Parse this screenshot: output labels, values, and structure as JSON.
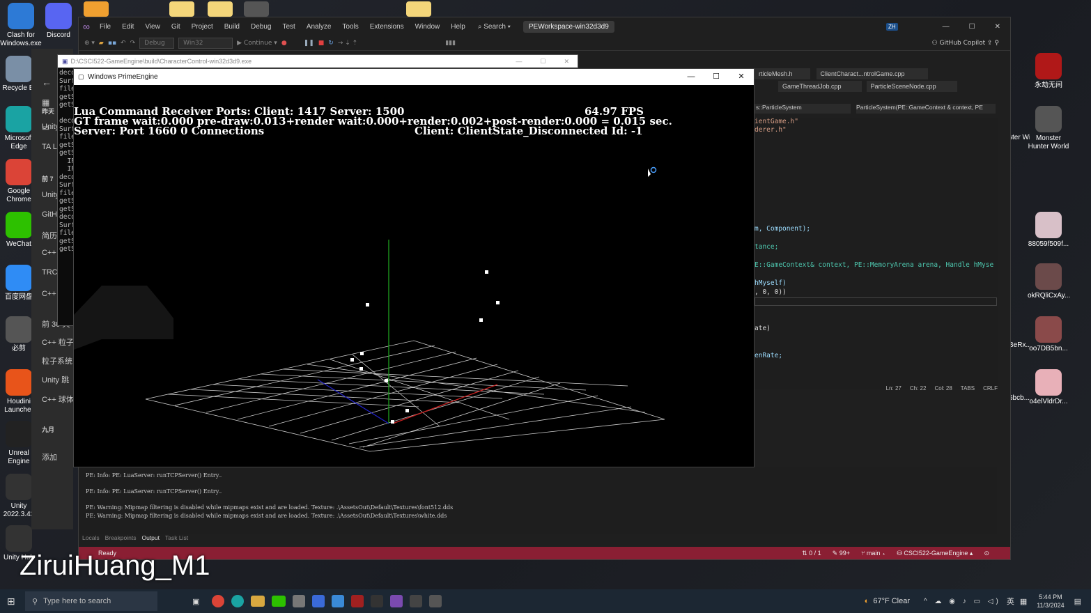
{
  "desktop": {
    "icons_left": [
      {
        "label": "Clash for Windows.exe",
        "icon": "clash-icon",
        "color": "#2d7ad6"
      },
      {
        "label": "Discord",
        "icon": "discord-icon",
        "color": "#5865f2"
      },
      {
        "label": "Recycle Bi",
        "icon": "recycle-bin-icon",
        "color": "#7a8fa6"
      },
      {
        "label": "Microsoft Edge",
        "icon": "edge-icon",
        "color": "#1aa3a3"
      },
      {
        "label": "Google Chrome",
        "icon": "chrome-icon",
        "color": "#db4437"
      },
      {
        "label": "WeChat",
        "icon": "wechat-icon",
        "color": "#2dc100"
      },
      {
        "label": "百度网盘",
        "icon": "baidu-netdisk-icon",
        "color": "#2f8cf5"
      },
      {
        "label": "必剪",
        "icon": "bijian-icon",
        "color": "#555"
      },
      {
        "label": "Houdini Launcher",
        "icon": "houdini-icon",
        "color": "#e8541a"
      },
      {
        "label": "Unreal Engine",
        "icon": "unreal-icon",
        "color": "#222"
      },
      {
        "label": "Unity 2022.3.43",
        "icon": "unity-icon",
        "color": "#333"
      },
      {
        "label": "Unity Hub",
        "icon": "unity-hub-icon",
        "color": "#333"
      }
    ],
    "icons_right": [
      {
        "label": "永劫无间",
        "icon": "naraka-icon",
        "color": "#b01818"
      },
      {
        "label": "Monster Hunter World",
        "icon": "mhw-icon",
        "color": "#555"
      },
      {
        "label": "88059f509f...",
        "icon": "image-icon",
        "color": "#d8c0c8"
      },
      {
        "label": "okRQliCxAy...",
        "icon": "image-icon",
        "color": "#6b4a4a"
      },
      {
        "label": "oo7DB5bn...",
        "icon": "image-icon",
        "color": "#8a4a4a"
      },
      {
        "label": "o4elVldrDr...",
        "icon": "image-icon",
        "color": "#e8b0b8"
      }
    ],
    "partial_icons": [
      "ster Wil...",
      "BeRx...",
      "5bcb..."
    ]
  },
  "vs": {
    "menu": [
      "File",
      "Edit",
      "View",
      "Git",
      "Project",
      "Build",
      "Debug",
      "Test",
      "Analyze",
      "Tools",
      "Extensions",
      "Window",
      "Help"
    ],
    "search": "Search",
    "solution": "PEWorkspace-win32d3d9",
    "profile": "ZH",
    "toolbar": {
      "config": "Debug",
      "platform": "Win32",
      "continue": "Continue"
    },
    "copilot": "GitHub Copilot",
    "tabs": [
      "rticleMesh.h",
      "ClientCharact...ntrolGame.cpp",
      "GameThreadJob.cpp",
      "ParticleSceneNode.cpp"
    ],
    "nav_scope": "s::ParticleSystem",
    "nav_member": "ParticleSystem(PE::GameContext & context, PE",
    "code_lines": [
      "ientGame.h\"",
      "derer.h\"",
      "m, Component);",
      "tance;",
      "E::GameContext& context, PE::MemoryArena arena, Handle hMyse",
      "hMyself)",
      ", 0, 0))",
      "ate)",
      "enRate;"
    ],
    "status_ln": "Ln: 27",
    "status_ch": "Ch: 22",
    "status_col": "Col: 28",
    "status_tabs": "TABS",
    "status_crlf": "CRLF",
    "output_lines": [
      "PE: Info: PE: LuaServer: runTCPServer() Entry..",
      "",
      "PE: Info: PE: LuaServer: runTCPServer() Entry..",
      "",
      "PE: Warning: Mipmap filtering is disabled while mipmaps exist and are loaded. Texture: .\\AssetsOut\\Default\\Textures\\font512.dds",
      "PE: Warning: Mipmap filtering is disabled while mipmaps exist and are loaded. Texture: .\\AssetsOut\\Default\\Textures\\white.dds"
    ],
    "output_tabs": [
      "Locals",
      "Breakpoints",
      "Output",
      "Task List"
    ],
    "statusbar": {
      "ready": "Ready",
      "changes": "0 / 1",
      "errors": "99+",
      "branch": "main",
      "repo": "CSCI522-GameEngine"
    }
  },
  "console": {
    "title": "D:\\CSCI522-GameEngine\\build\\CharacterControl-win32d3d9.exe",
    "lines": [
      "deco",
      "Surf",
      "file",
      "getS",
      "getS",
      "",
      "deco",
      "Surf",
      "file",
      "getS",
      "getS",
      "  IF",
      "  IF",
      "deco",
      "Surf",
      "file",
      "getS",
      "getS",
      "deco",
      "Surf",
      "file",
      "getS",
      "getS"
    ]
  },
  "history_sidebar": {
    "items": [
      "昨天",
      "Unity",
      "TA L",
      "前 7",
      "Unity",
      "GitH",
      "简历",
      "C++",
      "TRC",
      "C++ 粒子",
      "前 30 天",
      "C++ 粒子",
      "粒子系统",
      "Unity 跳",
      "C++ 球体",
      "九月",
      "添加"
    ]
  },
  "prime": {
    "title": "Windows PrimeEngine",
    "hud_line1": "Lua Command Receiver Ports: Client: 1417 Server: 1500",
    "fps": "64.97 FPS",
    "hud_line2": "GT frame wait:0.000 pre-draw:0.013+render wait:0.000+render:0.002+post-render:0.000 = 0.015 sec.",
    "hud_line3a": "Server: Port 1660 0 Connections",
    "hud_line3b": "Client: ClientState_Disconnected Id: -1"
  },
  "taskbar": {
    "search_placeholder": "Type here to search",
    "weather": "67°F Clear",
    "ime": "英",
    "time": "5:44 PM",
    "date": "11/3/2024"
  },
  "watermark": "ZiruiHuang_M1",
  "colors": {
    "vs_accent": "#68217a",
    "status_red": "#8a1f33"
  }
}
